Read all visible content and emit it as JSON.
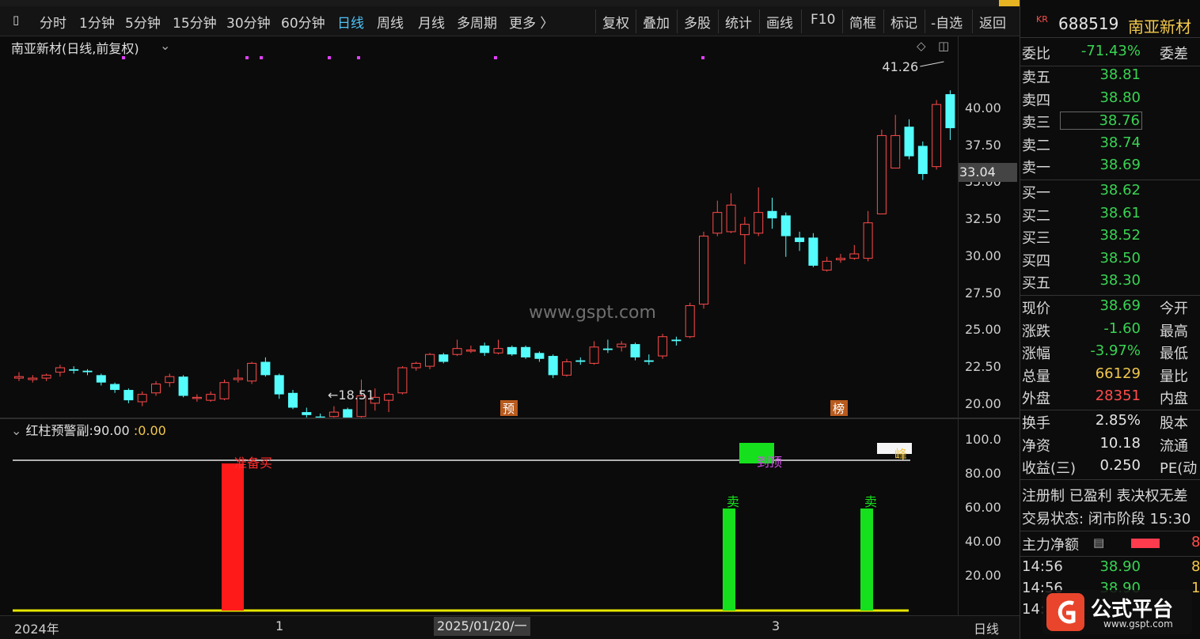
{
  "toolbar": {
    "items": [
      "分时",
      "1分钟",
      "5分钟",
      "15分钟",
      "30分钟",
      "60分钟",
      "日线",
      "周线",
      "月线",
      "多周期",
      "更多 〉",
      "复权",
      "叠加",
      "多股",
      "统计",
      "画线",
      "F10",
      "简框",
      "标记",
      "-自选",
      "返回"
    ],
    "active_index": 6
  },
  "chart": {
    "title": "南亚新材(日线,前复权)",
    "high_label": "41.26",
    "low_label": "←18.51",
    "marker_yu": "预",
    "marker_bang": "榜",
    "watermark": "www.gspt.com",
    "price_ticks": [
      "40.00",
      "37.50",
      "35.00",
      "32.50",
      "30.00",
      "27.50",
      "25.00",
      "22.50",
      "20.00"
    ],
    "current_price_tag": "33.04"
  },
  "indicator": {
    "name": "红柱预警副",
    "value1": "90.00",
    "value2": "0.00",
    "axis_ticks": [
      "100.0",
      "80.00",
      "60.00",
      "40.00",
      "20.00"
    ],
    "label_buy": "准备买",
    "label_sell1": "卖",
    "label_sell2": "卖",
    "label_top": "到顶",
    "label_peak": "峰"
  },
  "datebar": {
    "year": "2024年",
    "m1": "1",
    "cursor_date": "2025/01/20/一",
    "m3": "3",
    "period": "日线"
  },
  "rpanel": {
    "code_prefix": "KR",
    "code": "688519",
    "name": "南亚新材",
    "weibi_label": "委比",
    "weibi_val": "-71.43%",
    "weicha_label": "委差",
    "asks": [
      {
        "label": "卖五",
        "val": "38.81"
      },
      {
        "label": "卖四",
        "val": "38.80"
      },
      {
        "label": "卖三",
        "val": "38.76"
      },
      {
        "label": "卖二",
        "val": "38.74"
      },
      {
        "label": "卖一",
        "val": "38.69"
      }
    ],
    "bids": [
      {
        "label": "买一",
        "val": "38.62"
      },
      {
        "label": "买二",
        "val": "38.61"
      },
      {
        "label": "买三",
        "val": "38.52"
      },
      {
        "label": "买四",
        "val": "38.50"
      },
      {
        "label": "买五",
        "val": "38.30"
      }
    ],
    "quote": [
      {
        "label": "现价",
        "val": "38.69",
        "extra": "今开",
        "cls": "green"
      },
      {
        "label": "涨跌",
        "val": "-1.60",
        "extra": "最高",
        "cls": "green"
      },
      {
        "label": "涨幅",
        "val": "-3.97%",
        "extra": "最低",
        "cls": "green"
      },
      {
        "label": "总量",
        "val": "66129",
        "extra": "量比",
        "cls": "yellow"
      },
      {
        "label": "外盘",
        "val": "28351",
        "extra": "内盘",
        "cls": "red"
      }
    ],
    "stats": [
      {
        "label": "换手",
        "val": "2.85%",
        "extra": "股本"
      },
      {
        "label": "净资",
        "val": "10.18",
        "extra": "流通"
      },
      {
        "label": "收益(三)",
        "val": "0.250",
        "extra": "PE(动"
      }
    ],
    "info1": "注册制 已盈利 表决权无差",
    "info2": "交易状态: 闭市阶段 15:30",
    "main_net_label": "主力净额",
    "main_net_tail": "8",
    "ticks": [
      {
        "time": "14:56",
        "price": "38.90",
        "vol": "8"
      },
      {
        "time": "14:56",
        "price": "38.90",
        "vol": "1"
      },
      {
        "time": "14:",
        "price": "",
        "vol": ""
      }
    ]
  },
  "logo": {
    "text": "公式平台",
    "url": "www.gspt.com"
  },
  "chart_data": {
    "type": "candlestick",
    "title": "南亚新材(日线,前复权)",
    "ylim": [
      18,
      42
    ],
    "candles": [
      [
        21.8,
        21.9,
        22.2,
        21.6
      ],
      [
        21.7,
        21.8,
        22.0,
        21.5
      ],
      [
        21.8,
        22.0,
        22.1,
        21.6
      ],
      [
        22.2,
        22.5,
        22.7,
        21.9
      ],
      [
        22.4,
        22.3,
        22.6,
        22.1
      ],
      [
        22.3,
        22.2,
        22.4,
        22.0
      ],
      [
        22.0,
        21.5,
        22.1,
        21.3
      ],
      [
        21.4,
        21.0,
        21.5,
        20.8
      ],
      [
        21.0,
        20.3,
        21.1,
        20.1
      ],
      [
        20.2,
        20.7,
        20.9,
        19.9
      ],
      [
        20.8,
        21.4,
        21.6,
        20.6
      ],
      [
        21.5,
        21.9,
        22.1,
        21.2
      ],
      [
        21.9,
        20.6,
        22.0,
        20.5
      ],
      [
        20.5,
        20.5,
        20.7,
        20.2
      ],
      [
        20.3,
        20.7,
        20.9,
        20.2
      ],
      [
        20.4,
        21.5,
        21.7,
        20.3
      ],
      [
        21.7,
        21.8,
        22.4,
        21.5
      ],
      [
        21.6,
        22.8,
        22.9,
        21.4
      ],
      [
        22.9,
        22.0,
        23.2,
        21.9
      ],
      [
        22.0,
        20.7,
        22.1,
        20.4
      ],
      [
        20.8,
        19.8,
        21.0,
        19.7
      ],
      [
        19.5,
        19.3,
        19.8,
        19.0
      ],
      [
        19.2,
        19.0,
        19.4,
        18.8
      ],
      [
        19.2,
        19.5,
        19.9,
        19.0
      ],
      [
        19.7,
        19.1,
        19.8,
        18.6
      ],
      [
        19.2,
        20.6,
        21.7,
        19.1
      ],
      [
        20.1,
        20.5,
        21.1,
        19.6
      ],
      [
        20.3,
        20.7,
        20.8,
        19.5
      ],
      [
        20.8,
        22.5,
        22.6,
        20.7
      ],
      [
        22.5,
        22.8,
        22.9,
        22.3
      ],
      [
        22.6,
        23.4,
        23.5,
        22.4
      ],
      [
        23.4,
        22.9,
        23.5,
        22.8
      ],
      [
        23.4,
        23.8,
        24.4,
        23.3
      ],
      [
        23.7,
        23.7,
        24.0,
        23.5
      ],
      [
        24.0,
        23.5,
        24.2,
        23.3
      ],
      [
        23.5,
        23.8,
        24.4,
        23.4
      ],
      [
        23.9,
        23.4,
        24.0,
        23.3
      ],
      [
        23.9,
        23.2,
        24.0,
        23.1
      ],
      [
        23.5,
        23.1,
        23.6,
        22.9
      ],
      [
        23.3,
        22.0,
        23.4,
        21.8
      ],
      [
        22.0,
        22.9,
        23.1,
        21.9
      ],
      [
        23.0,
        22.9,
        23.2,
        22.7
      ],
      [
        22.8,
        23.9,
        24.3,
        22.7
      ],
      [
        23.8,
        23.7,
        24.4,
        23.5
      ],
      [
        23.9,
        24.1,
        24.3,
        23.6
      ],
      [
        24.1,
        23.2,
        24.2,
        23.0
      ],
      [
        23.0,
        22.9,
        23.4,
        22.7
      ],
      [
        23.3,
        24.6,
        24.8,
        23.1
      ],
      [
        24.4,
        24.3,
        24.6,
        24.0
      ],
      [
        24.6,
        26.7,
        26.9,
        24.5
      ],
      [
        26.8,
        31.4,
        31.7,
        26.5
      ],
      [
        31.6,
        33.0,
        33.8,
        31.4
      ],
      [
        31.7,
        33.5,
        34.3,
        31.6
      ],
      [
        31.5,
        32.2,
        32.7,
        29.5
      ],
      [
        31.6,
        33.0,
        34.7,
        31.4
      ],
      [
        33.1,
        32.6,
        34.0,
        31.9
      ],
      [
        32.8,
        31.4,
        33.0,
        30.0
      ],
      [
        31.3,
        31.0,
        31.7,
        30.4
      ],
      [
        31.3,
        29.4,
        31.6,
        29.3
      ],
      [
        29.1,
        29.7,
        30.0,
        29.0
      ],
      [
        29.8,
        29.9,
        30.2,
        29.6
      ],
      [
        29.9,
        30.2,
        30.8,
        29.8
      ],
      [
        29.9,
        32.3,
        33.1,
        29.7
      ],
      [
        32.9,
        38.2,
        38.6,
        32.9
      ],
      [
        36.0,
        38.2,
        39.6,
        36.0
      ],
      [
        38.8,
        36.8,
        39.3,
        36.6
      ],
      [
        37.5,
        35.6,
        37.8,
        35.2
      ],
      [
        36.1,
        40.3,
        40.6,
        35.9
      ],
      [
        41.0,
        38.7,
        41.26,
        37.9
      ]
    ]
  }
}
